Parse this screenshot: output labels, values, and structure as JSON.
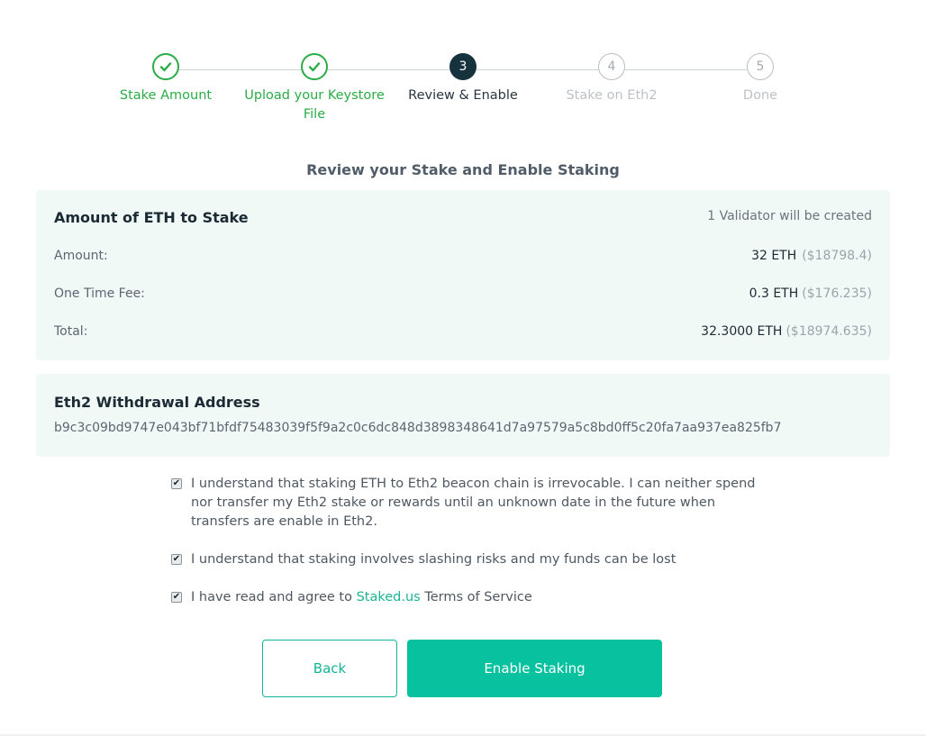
{
  "stepper": {
    "steps": [
      {
        "number": "1",
        "label": "Stake Amount",
        "state": "done"
      },
      {
        "number": "2",
        "label": "Upload your Keystore File",
        "state": "done"
      },
      {
        "number": "3",
        "label": "Review & Enable",
        "state": "current"
      },
      {
        "number": "4",
        "label": "Stake on Eth2",
        "state": "todo"
      },
      {
        "number": "5",
        "label": "Done",
        "state": "todo"
      }
    ]
  },
  "page_title": "Review your Stake and Enable Staking",
  "stake_card": {
    "heading": "Amount of ETH to Stake",
    "validator_note": "1 Validator will be created",
    "rows": [
      {
        "label": "Amount:",
        "eth": "32 ETH",
        "usd": "($18798.4)"
      },
      {
        "label": "One Time Fee:",
        "eth": "0.3 ETH",
        "usd": "($176.235)"
      },
      {
        "label": "Total:",
        "eth": "32.3000 ETH",
        "usd": "($18974.635)"
      }
    ]
  },
  "withdrawal_card": {
    "heading": "Eth2 Withdrawal Address",
    "address": "b9c3c09bd9747e043bf71bfdf75483039f5f9a2c0c6dc848d3898348641d7a97579a5c8bd0ff5c20fa7aa937ea825fb7"
  },
  "agreements": [
    {
      "checked": true,
      "text": "I understand that staking ETH to Eth2 beacon chain is irrevocable. I can neither spend nor transfer my Eth2 stake or rewards until an unknown date in the future when transfers are enable in Eth2."
    },
    {
      "checked": true,
      "text": "I understand that staking involves slashing risks and my funds can be lost"
    },
    {
      "checked": true,
      "text_before": "I have read and agree to ",
      "link": "Staked.us",
      "text_after": " Terms of Service"
    }
  ],
  "buttons": {
    "back": "Back",
    "enable": "Enable Staking"
  },
  "colors": {
    "done_green": "#2aac46",
    "current_step": "#15323d",
    "accent_teal": "#07c19f",
    "card_bg": "#f1f9f7"
  }
}
